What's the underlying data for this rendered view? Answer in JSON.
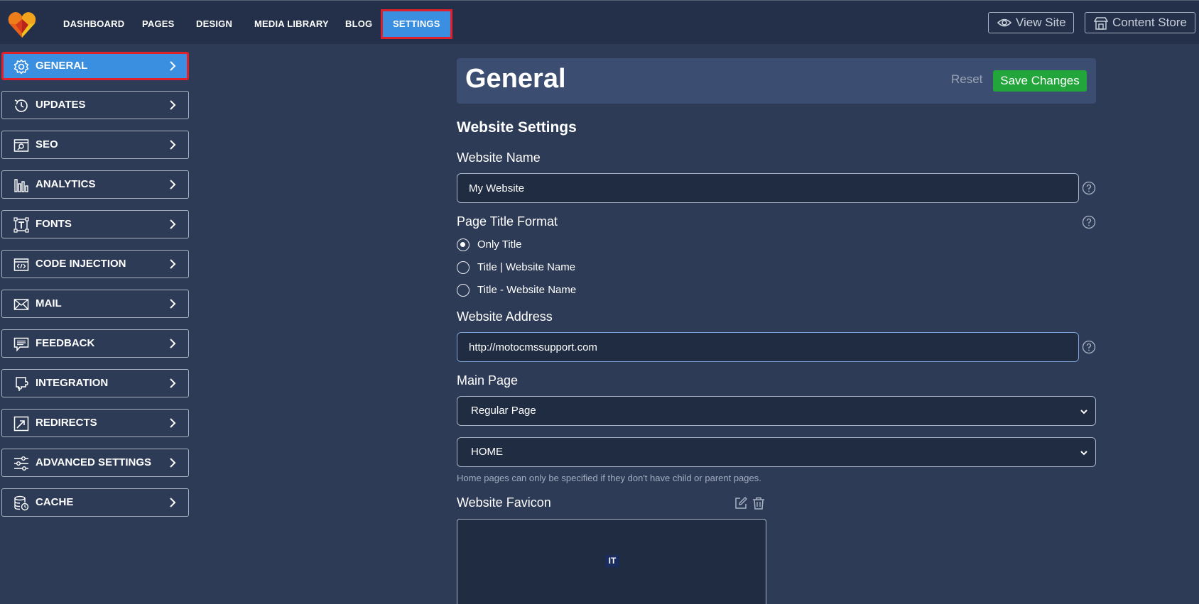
{
  "nav": {
    "items": [
      "DASHBOARD",
      "PAGES",
      "DESIGN",
      "MEDIA LIBRARY",
      "BLOG",
      "SETTINGS"
    ],
    "active": "SETTINGS",
    "view_site": "View Site",
    "content_store": "Content Store"
  },
  "sidebar": {
    "items": [
      {
        "label": "GENERAL",
        "icon": "gear-icon"
      },
      {
        "label": "UPDATES",
        "icon": "history-icon"
      },
      {
        "label": "SEO",
        "icon": "seo-icon"
      },
      {
        "label": "ANALYTICS",
        "icon": "analytics-icon"
      },
      {
        "label": "FONTS",
        "icon": "fonts-icon"
      },
      {
        "label": "CODE INJECTION",
        "icon": "code-icon"
      },
      {
        "label": "MAIL",
        "icon": "mail-icon"
      },
      {
        "label": "FEEDBACK",
        "icon": "feedback-icon"
      },
      {
        "label": "INTEGRATION",
        "icon": "integration-icon"
      },
      {
        "label": "REDIRECTS",
        "icon": "redirect-icon"
      },
      {
        "label": "ADVANCED SETTINGS",
        "icon": "sliders-icon"
      },
      {
        "label": "CACHE",
        "icon": "cache-icon"
      }
    ],
    "active": "GENERAL"
  },
  "main": {
    "title": "General",
    "reset_label": "Reset",
    "save_label": "Save Changes",
    "section_title": "Website Settings",
    "website_name_label": "Website Name",
    "website_name_value": "My Website",
    "title_format_label": "Page Title Format",
    "title_format_options": [
      "Only Title",
      "Title | Website Name",
      "Title - Website Name"
    ],
    "title_format_selected": "Only Title",
    "website_address_label": "Website Address",
    "website_address_value": "http://motocmssupport.com",
    "main_page_label": "Main Page",
    "main_page_type": "Regular Page",
    "main_page_value": "HOME",
    "main_page_hint": "Home pages can only be specified if they don't have child or parent pages.",
    "favicon_label": "Website Favicon",
    "favicon_badge": "IT"
  },
  "colors": {
    "background": "#2d3b56",
    "topbar": "#243049",
    "accent": "#3a8fe0",
    "save": "#22a53a",
    "highlight_border": "#e0202a"
  }
}
